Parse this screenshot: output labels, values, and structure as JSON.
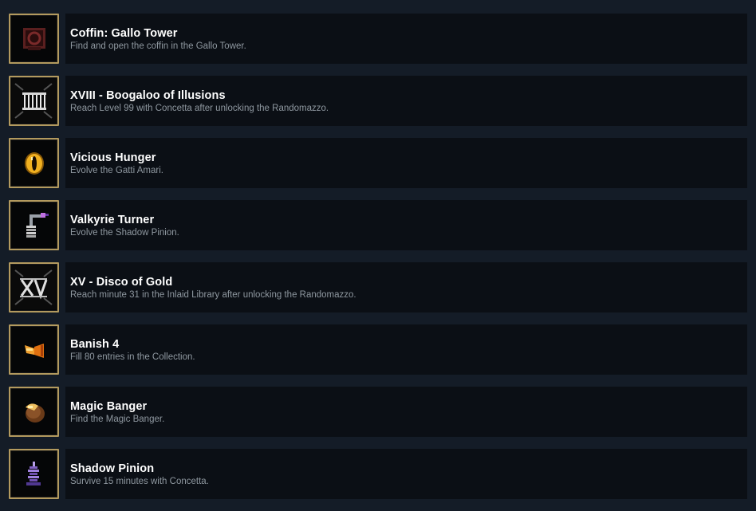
{
  "achievements": [
    {
      "title": "Coffin: Gallo Tower",
      "description": "Find and open the coffin in the Gallo Tower.",
      "icon": "coffin-icon"
    },
    {
      "title": "XVIII - Boogaloo of Illusions",
      "description": "Reach Level 99 with Concetta after unlocking the Randomazzo.",
      "icon": "roman-xviii-card-icon"
    },
    {
      "title": "Vicious Hunger",
      "description": "Evolve the Gatti Amari.",
      "icon": "golden-eye-icon"
    },
    {
      "title": "Valkyrie Turner",
      "description": "Evolve the Shadow Pinion.",
      "icon": "valkyrie-pinion-icon"
    },
    {
      "title": "XV - Disco of Gold",
      "description": "Reach minute 31 in the Inlaid Library after unlocking the Randomazzo.",
      "icon": "roman-xv-card-icon"
    },
    {
      "title": "Banish 4",
      "description": "Fill 80 entries in the Collection.",
      "icon": "banish-horn-icon"
    },
    {
      "title": "Magic Banger",
      "description": "Find the Magic Banger.",
      "icon": "magic-banger-icon"
    },
    {
      "title": "Shadow Pinion",
      "description": "Survive 15 minutes with Concetta.",
      "icon": "shadow-pinion-icon"
    }
  ]
}
